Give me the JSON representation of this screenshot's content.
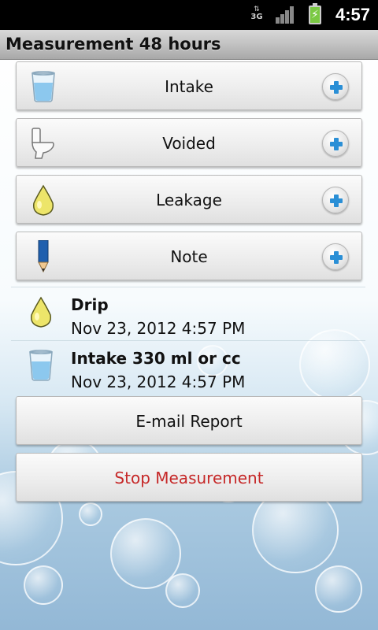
{
  "status_bar": {
    "network": "3G",
    "time": "4:57"
  },
  "title_bar": {
    "title": "Measurement 48 hours"
  },
  "actions": [
    {
      "label": "Intake",
      "icon": "water-glass-icon"
    },
    {
      "label": "Voided",
      "icon": "toilet-icon"
    },
    {
      "label": "Leakage",
      "icon": "drop-icon"
    },
    {
      "label": "Note",
      "icon": "pencil-icon"
    }
  ],
  "log": [
    {
      "title": "Drip",
      "date": "Nov 23, 2012 4:57 PM",
      "icon": "drop-icon"
    },
    {
      "title": "Intake 330 ml or cc",
      "date": "Nov 23, 2012 4:57 PM",
      "icon": "water-glass-icon"
    }
  ],
  "buttons": {
    "email": "E-mail Report",
    "stop": "Stop Measurement"
  },
  "colors": {
    "plus_accent": "#2a8fd6",
    "stop_text": "#c62828",
    "battery": "#7ac943"
  }
}
